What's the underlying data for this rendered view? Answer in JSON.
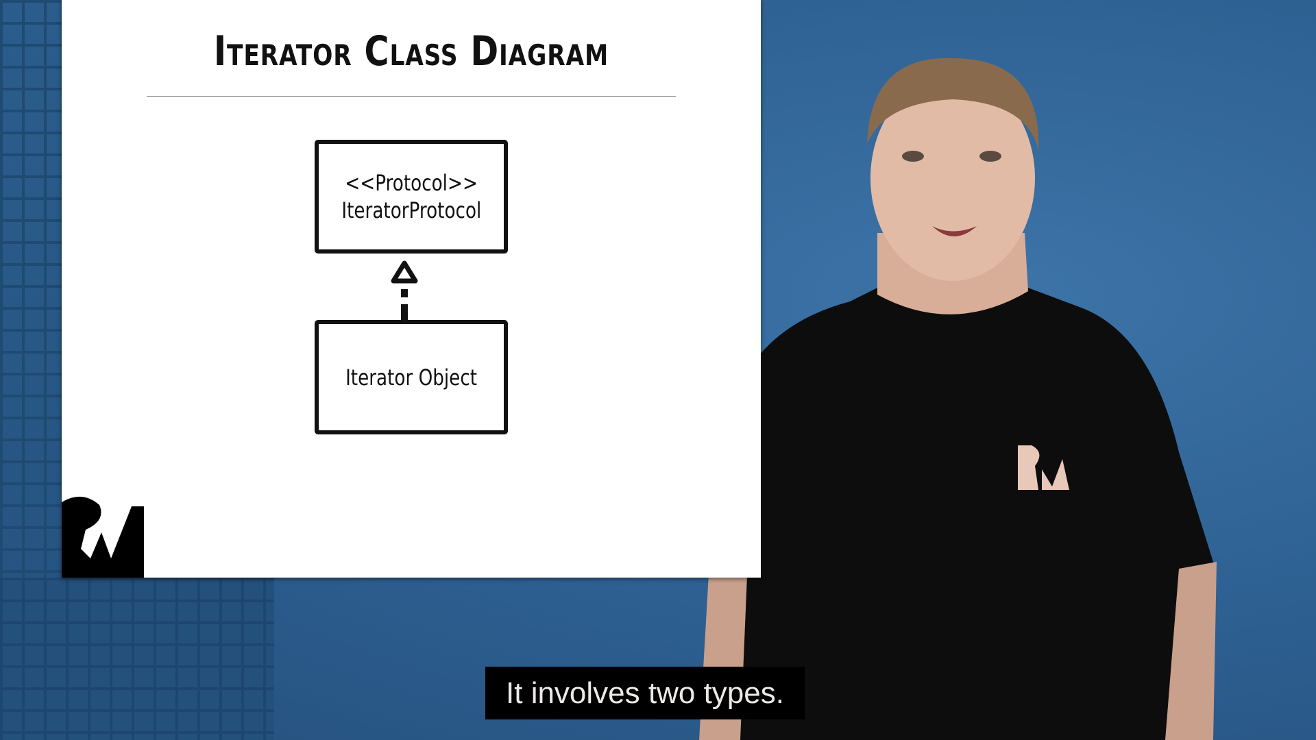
{
  "slide": {
    "title": "Iterator Class Diagram",
    "protocol_box": {
      "stereotype": "<<Protocol>>",
      "name": "IteratorProtocol"
    },
    "object_box": {
      "name": "Iterator Object"
    },
    "logo": "RW"
  },
  "caption": {
    "text": "It involves two types."
  },
  "colors": {
    "background": "#2f6394",
    "slide": "#ffffff",
    "caption_bg": "#000000"
  }
}
